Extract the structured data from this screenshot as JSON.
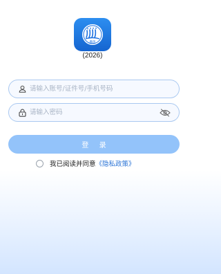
{
  "app": {
    "logo_icon": "app-logo-icon",
    "logo_text": "鹿邑",
    "version": "(2026)"
  },
  "form": {
    "account": {
      "icon": "user-icon",
      "placeholder": "请输入账号/证件号/手机号码",
      "value": ""
    },
    "password": {
      "icon": "lock-icon",
      "placeholder": "请输入密码",
      "value": "",
      "visibility_icon": "eye-off-icon"
    },
    "login_button": "登 录"
  },
  "agreement": {
    "checked": false,
    "text": "我已阅读并同意",
    "policy_link": "《隐私政策》"
  },
  "colors": {
    "primary": "#1a6fe0",
    "button_disabled": "#93c3fa",
    "field_border": "#a9c8f0",
    "link": "#2b74d6"
  }
}
